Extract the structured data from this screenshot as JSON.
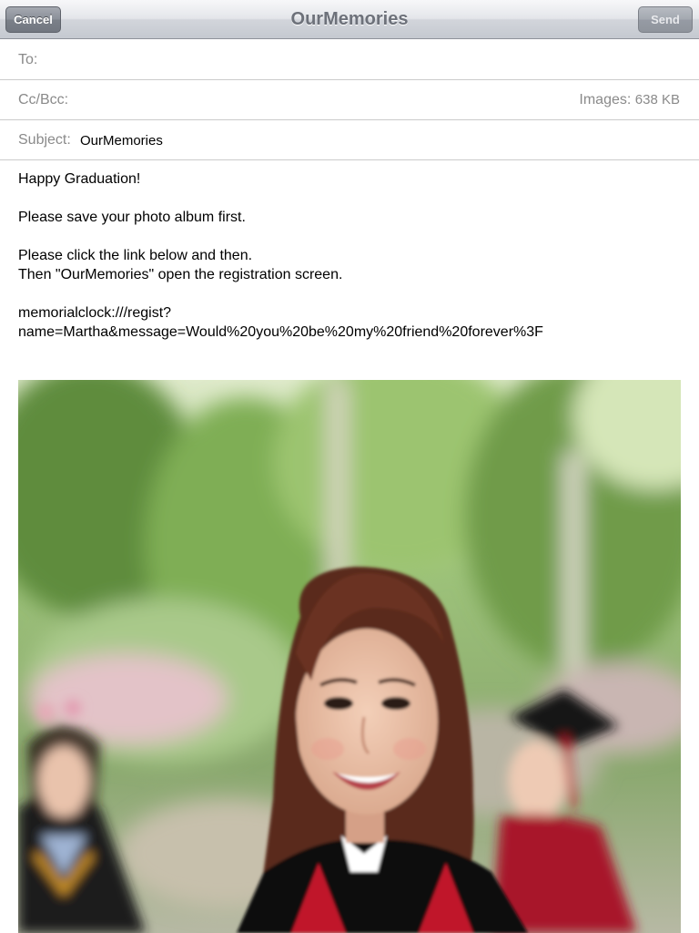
{
  "navbar": {
    "title": "OurMemories",
    "cancel_label": "Cancel",
    "send_label": "Send"
  },
  "fields": {
    "to_label": "To:",
    "to_value": "",
    "cc_label": "Cc/Bcc:",
    "images_label": "Images:",
    "images_size": "638 KB",
    "subject_label": "Subject:",
    "subject_value": "OurMemories"
  },
  "body": {
    "line1": "Happy Graduation!",
    "line2": "Please save your photo album first.",
    "line3": "Please click the link below and then.",
    "line4": "Then \"OurMemories\" open the registration screen.",
    "link_part1": "memorialclock:///regist?",
    "link_part2": "name=Martha&message=Would%20you%20be%20my%20friend%20forever%3F"
  },
  "attachment": {
    "kind": "graduation-photo"
  },
  "colors": {
    "navbar_top": "#f7f7f9",
    "navbar_bottom": "#c5c9d0",
    "label_gray": "#8a8a8a",
    "separator": "#cbcbcb"
  }
}
